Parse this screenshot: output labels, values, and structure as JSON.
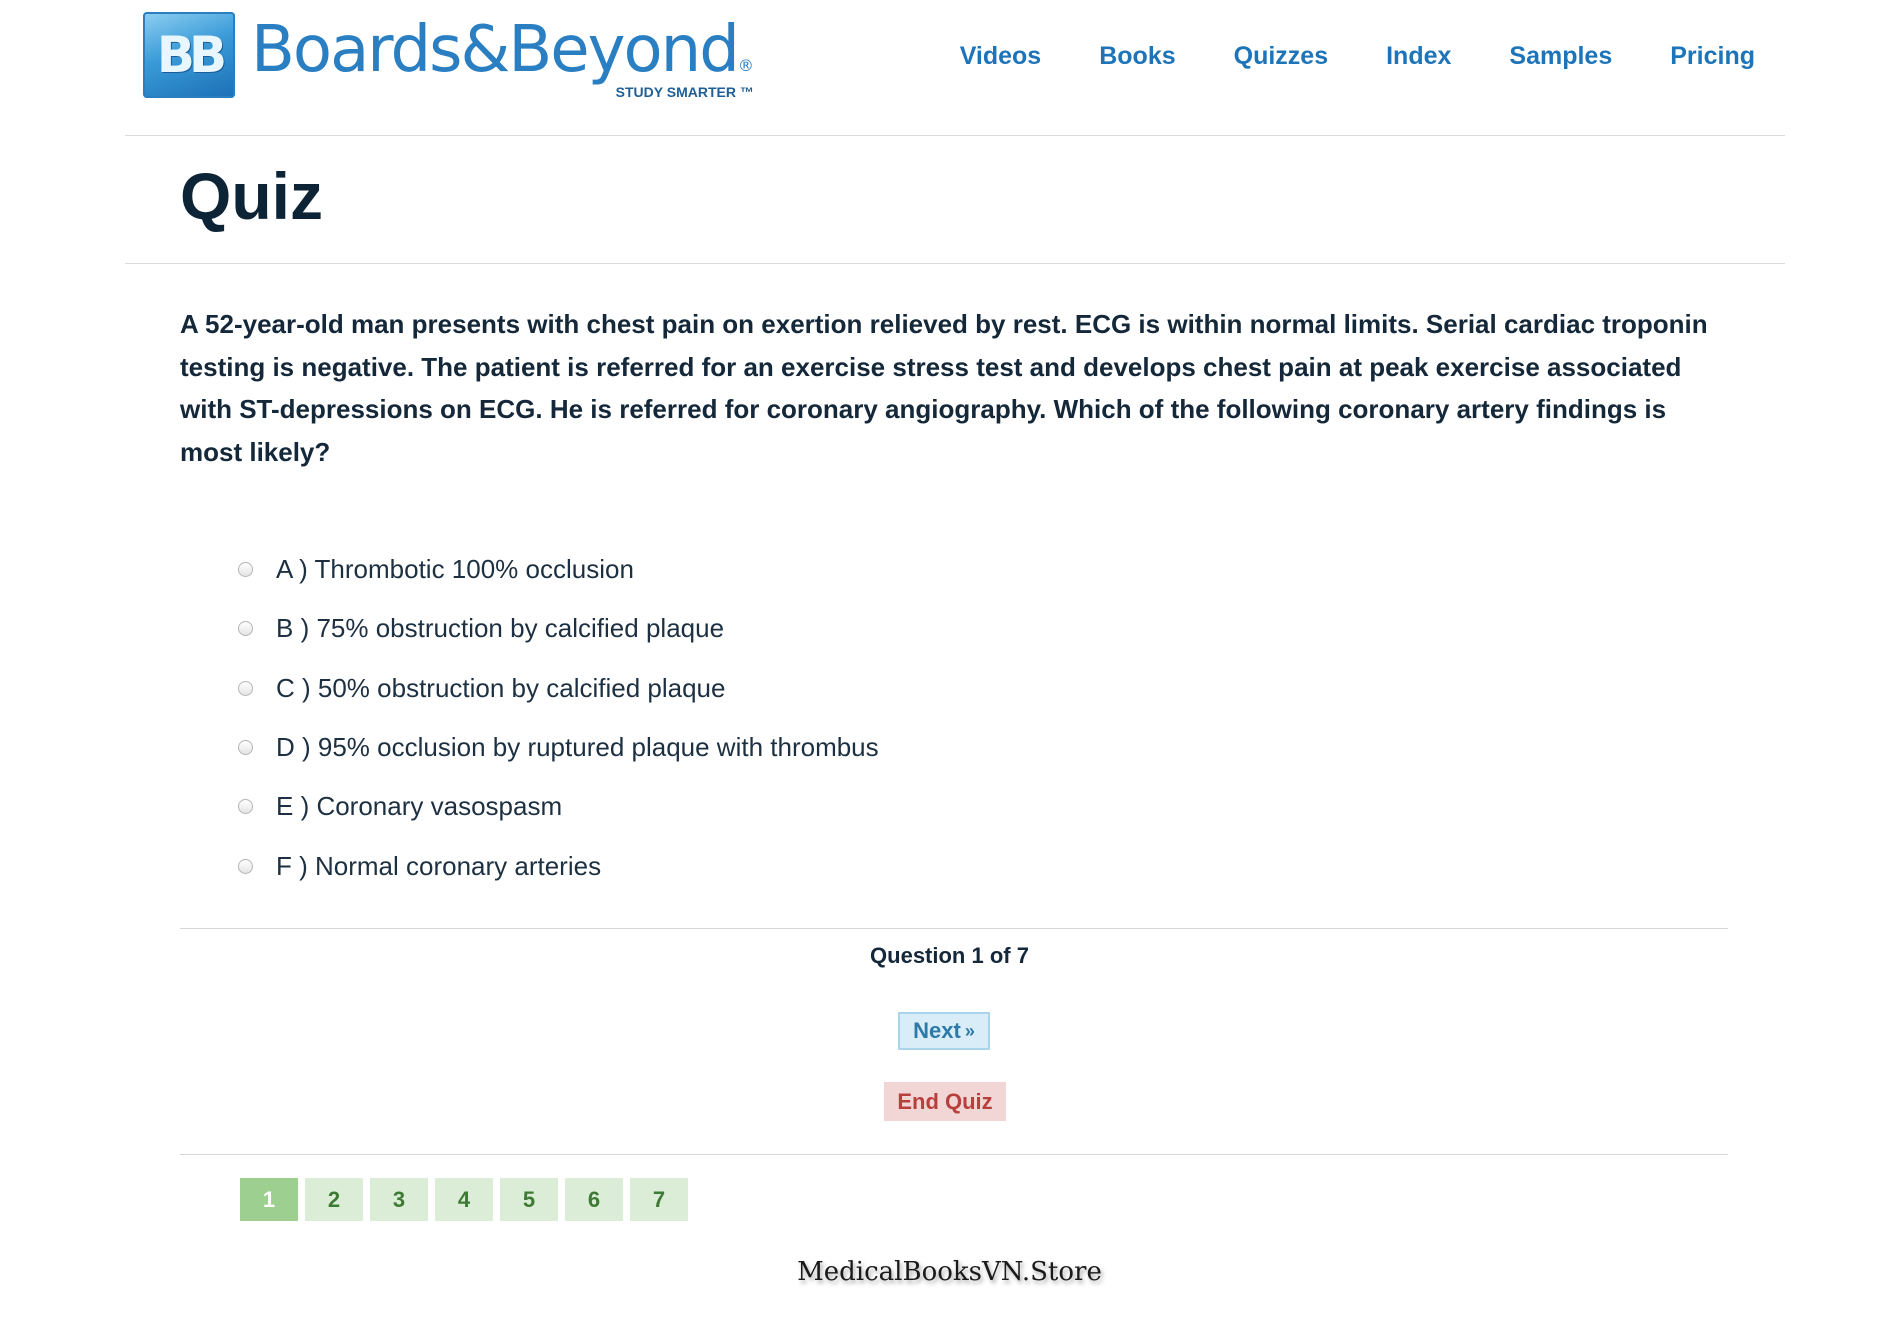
{
  "header": {
    "logo": {
      "badge": "BB",
      "wordmark": "Boards&Beyond",
      "registered": "®",
      "tagline": "STUDY SMARTER ™"
    },
    "nav": [
      "Videos",
      "Books",
      "Quizzes",
      "Index",
      "Samples",
      "Pricing"
    ]
  },
  "page_title": "Quiz",
  "question": {
    "text": "A 52-year-old man presents with chest pain on exertion relieved by rest. ECG is within normal limits. Serial cardiac troponin testing is negative. The patient is referred for an exercise stress test and develops chest pain at peak exercise associated with ST-depressions on ECG. He is referred for coronary angiography. Which of the following coronary artery findings is most likely?",
    "answers": [
      "A ) Thrombotic 100% occlusion",
      "B ) 75% obstruction by calcified plaque",
      "C ) 50% obstruction by calcified plaque",
      "D ) 95% occlusion by ruptured plaque with thrombus",
      "E ) Coronary vasospasm",
      "F ) Normal coronary arteries"
    ]
  },
  "progress": {
    "counter": "Question 1 of 7",
    "current": 1,
    "total": 7
  },
  "buttons": {
    "next": "Next",
    "next_icon": "»",
    "end": "End Quiz"
  },
  "pager": [
    "1",
    "2",
    "3",
    "4",
    "5",
    "6",
    "7"
  ],
  "watermark": "MedicalBooksVN.Store",
  "colors": {
    "brand_blue": "#1e74b8",
    "title_dark": "#0d2436",
    "next_bg": "#d9edf8",
    "end_bg": "#f2d6d6",
    "end_text": "#b8403c",
    "pager_bg": "#dcedd7",
    "pager_active": "#9ccf90"
  }
}
